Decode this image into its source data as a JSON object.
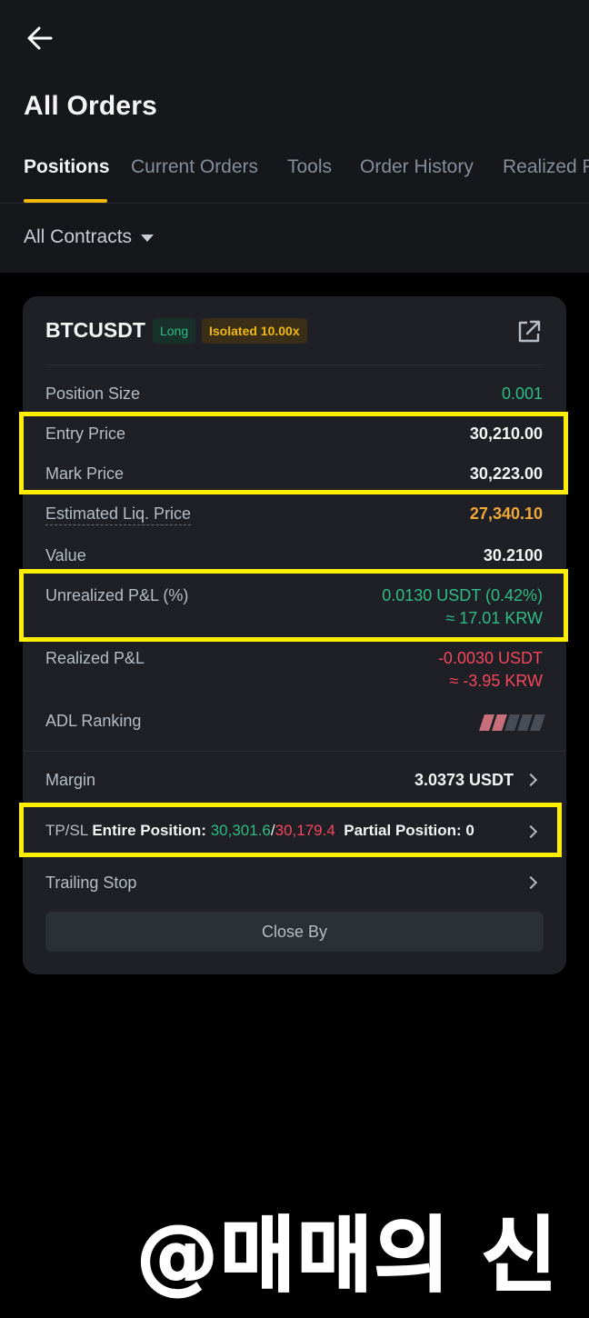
{
  "header": {
    "title": "All Orders",
    "tabs": [
      "Positions",
      "Current Orders",
      "Tools",
      "Order History",
      "Realized P"
    ]
  },
  "filter": {
    "label": "All Contracts"
  },
  "position": {
    "symbol": "BTCUSDT",
    "side": "Long",
    "margin_mode": "Isolated 10.00x",
    "rows": {
      "size_label": "Position Size",
      "size_value": "0.001",
      "entry_label": "Entry Price",
      "entry_value": "30,210.00",
      "mark_label": "Mark Price",
      "mark_value": "30,223.00",
      "liq_label": "Estimated Liq. Price",
      "liq_value": "27,340.10",
      "value_label": "Value",
      "value_value": "30.2100",
      "upnl_label": "Unrealized P&L (%)",
      "upnl_value": "0.0130 USDT (0.42%)",
      "upnl_krw": "≈ 17.01 KRW",
      "rpnl_label": "Realized P&L",
      "rpnl_value": "-0.0030 USDT",
      "rpnl_krw": "≈ -3.95 KRW",
      "adl_label": "ADL Ranking",
      "margin_label": "Margin",
      "margin_value": "3.0373 USDT"
    },
    "adl_level": 2,
    "adl_max": 5,
    "tpsl": {
      "label": "TP/SL",
      "entire_label": "Entire Position:",
      "tp": "30,301.6",
      "sep": "/",
      "sl": "30,179.4",
      "partial_label": "Partial Position: 0"
    },
    "trailing_label": "Trailing Stop",
    "close_by_label": "Close By"
  },
  "watermark": "@매매의 신",
  "colors": {
    "accent": "#f0b90b",
    "positive": "#2ebd85",
    "negative": "#f6465d",
    "highlight": "#ffee00"
  }
}
